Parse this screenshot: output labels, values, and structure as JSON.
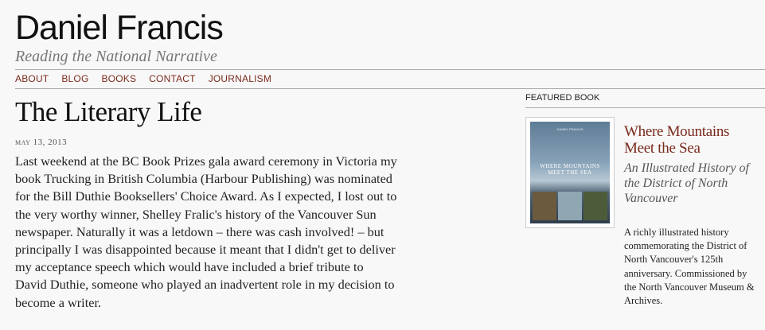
{
  "header": {
    "site_title": "Daniel Francis",
    "tagline": "Reading the National Narrative"
  },
  "nav": {
    "items": [
      {
        "label": "ABOUT"
      },
      {
        "label": "BLOG"
      },
      {
        "label": "BOOKS"
      },
      {
        "label": "CONTACT"
      },
      {
        "label": "JOURNALISM"
      }
    ],
    "link_color": "#7a2a1d"
  },
  "post": {
    "title": "The Literary Life",
    "date": "MAY 13, 2013",
    "body": "Last weekend at the BC Book Prizes gala award ceremony in Victoria my book Trucking in British Columbia (Harbour Publishing) was nominated for the Bill Duthie Booksellers' Choice Award. As I expected, I lost out to the very worthy winner, Shelley Fralic's history of the Vancouver Sun newspaper. Naturally it was a letdown – there was cash involved! – but principally I was disappointed because it meant that I didn't get to deliver my acceptance speech which would have included a brief tribute to David Duthie, someone who played an inadvertent role in my decision to become a writer."
  },
  "sidebar": {
    "heading": "FEATURED BOOK",
    "book": {
      "cover_author": "DANIEL FRANCIS",
      "cover_title": "WHERE MOUNTAINS MEET THE SEA",
      "title": "Where Mountains Meet the Sea",
      "subtitle": "An Illustrated History of the District of North Vancouver",
      "description": "A richly illustrated history commemorating the District of North Vancouver's 125th anniversary. Commissioned by the North Vancouver Museum & Archives."
    }
  }
}
